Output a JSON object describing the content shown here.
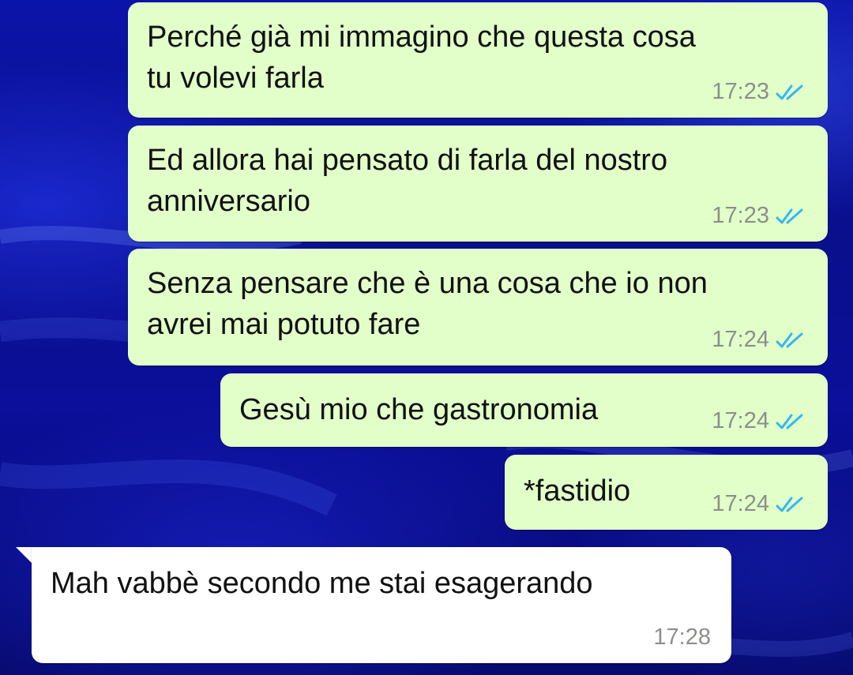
{
  "colors": {
    "outgoing_bubble": "#e2ffc9",
    "incoming_bubble": "#ffffff",
    "read_ticks": "#34b7f1",
    "timestamp": "#8b8f8a",
    "wallpaper": "#0b14a8"
  },
  "messages": [
    {
      "direction": "outgoing",
      "text": "Perché già mi immagino che questa cosa\ntu volevi farla",
      "time": "17:23",
      "status_icon": "double-check-read-icon"
    },
    {
      "direction": "outgoing",
      "text": "Ed allora hai pensato di farla del nostro\nanniversario",
      "time": "17:23",
      "status_icon": "double-check-read-icon"
    },
    {
      "direction": "outgoing",
      "text": "Senza pensare che è una cosa che io non\navrei mai potuto fare",
      "time": "17:24",
      "status_icon": "double-check-read-icon"
    },
    {
      "direction": "outgoing",
      "text": "Gesù mio che gastronomia",
      "time": "17:24",
      "status_icon": "double-check-read-icon"
    },
    {
      "direction": "outgoing",
      "text": "*fastidio",
      "time": "17:24",
      "status_icon": "double-check-read-icon"
    },
    {
      "direction": "incoming",
      "text": "Mah vabbè secondo me stai esagerando",
      "time": "17:28"
    }
  ]
}
